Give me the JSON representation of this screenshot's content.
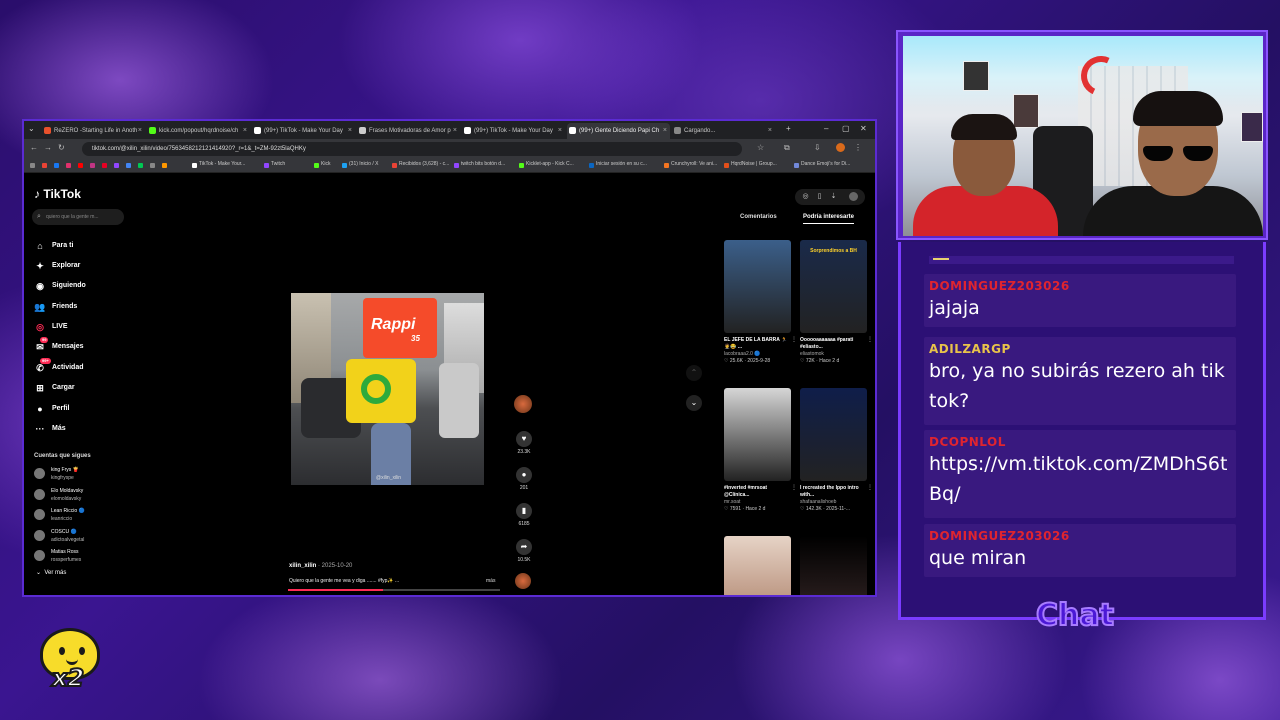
{
  "browser": {
    "tabs": [
      {
        "label": "ReZERO -Starting Life in Anoth",
        "color": "#e8512c",
        "active": false
      },
      {
        "label": "kick.com/popout/hqrdnoise/ch",
        "color": "#53fc18",
        "active": false
      },
      {
        "label": "(99+) TikTok - Make Your Day",
        "color": "#ffffff",
        "active": false
      },
      {
        "label": "Frases Motivadoras de Amor p",
        "color": "#cccccc",
        "active": false
      },
      {
        "label": "(99+) TikTok - Make Your Day",
        "color": "#ffffff",
        "active": false
      },
      {
        "label": "(99+) Gente Diciendo Papi Ch",
        "color": "#ffffff",
        "active": true
      },
      {
        "label": "Cargando...",
        "color": "#888888",
        "active": false
      }
    ],
    "new_tab": "+",
    "window_controls": [
      "–",
      "▢",
      "✕"
    ],
    "url": "tiktok.com/@xilin_xilin/video/7563458212121414920?_r=1&_t=ZM-92zt5laQHKy",
    "bookmarks": [
      "TikTok - Make Your...",
      "Twitch",
      "Kick",
      "(31) Inicio / X",
      "Recibidos (3,628) - c...",
      "twitch bits botón d...",
      "Kicklet-app - Kick C...",
      "Iniciar sesión en su c...",
      "Crunchyroll: Ve ani...",
      "HqrdNoise | Group...",
      "Dance Emoji's for Di..."
    ]
  },
  "tiktok": {
    "logo": "TikTok",
    "search_placeholder": "quiero que la gente m...",
    "nav": [
      {
        "label": "Para ti",
        "icon": "⌂"
      },
      {
        "label": "Explorar",
        "icon": "✦"
      },
      {
        "label": "Siguiendo",
        "icon": "◉"
      },
      {
        "label": "Friends",
        "icon": "👥"
      },
      {
        "label": "LIVE",
        "icon": "◎"
      },
      {
        "label": "Mensajes",
        "icon": "✉",
        "badge": "99"
      },
      {
        "label": "Actividad",
        "icon": "✆",
        "badge": "99+"
      },
      {
        "label": "Cargar",
        "icon": "⊞"
      },
      {
        "label": "Perfil",
        "icon": "●"
      },
      {
        "label": "Más",
        "icon": "···"
      }
    ],
    "following_title": "Cuentas que sigues",
    "following": [
      {
        "name": "king Frys 🍟",
        "handle": "kingfryspe"
      },
      {
        "name": "Elo Moldavsky",
        "handle": "elomoldavsky"
      },
      {
        "name": "Lean Riccio 🔵",
        "handle": "leanriccio"
      },
      {
        "name": "COSCU 🔵",
        "handle": "adictoalvegetal"
      },
      {
        "name": "Matias Ross",
        "handle": "rossperfumes"
      }
    ],
    "see_more": "Ver más",
    "video": {
      "bag_text": "Rappi",
      "bag_num": "35",
      "watermark": "@xilin_xilin",
      "author": "xilin_xilin",
      "date": "· 2025-10-20",
      "caption": "Quiero que la gente me vea y diga ....... #fyp✨ ...",
      "more": "más",
      "progress": 0.45
    },
    "actions": {
      "likes": "23.3K",
      "comments": "201",
      "saves": "6185",
      "shares": "10.5K"
    },
    "panel_tabs": [
      "Comentarios",
      "Podría interesarte"
    ],
    "cards": [
      {
        "title": "EL JEFE DE LA BARRA 🏃🤵😂 ...",
        "author": "lacobraaa2.0 🔵",
        "stats": "♡ 25.6K · 2025-9-28",
        "thumb": "#3b5f8a",
        "overlay": ""
      },
      {
        "title": "Oooooaaaaaaa #parati #eliasto...",
        "author": "eliastomok",
        "stats": "♡ 72K · Hace 2 d",
        "thumb": "#1a2a4a",
        "overlay": "Sorprendimos a BH"
      },
      {
        "title": "#inverted #mrsoat @Clínica...",
        "author": "mr.soat",
        "stats": "♡ 7591 · Hace 2 d",
        "thumb": "#d6d6d6",
        "overlay": ""
      },
      {
        "title": "I recreated the Ippo intro with...",
        "author": "shafaanalishoeb",
        "stats": "♡ 142.3K · 2025-11-...",
        "thumb": "#0f1e4a",
        "overlay": ""
      }
    ]
  },
  "chat": {
    "messages": [
      {
        "user": "DOMINGUEZ203026",
        "color": "#e0242f",
        "text": "jajaja"
      },
      {
        "user": "ADILZARGP",
        "color": "#e9c34a",
        "text": "bro, ya no subirás rezero ah tiktok?"
      },
      {
        "user": "DCOPNLOL",
        "color": "#e0242f",
        "text": "https://vm.tiktok.com/ZMDhS6tBq/"
      },
      {
        "user": "DOMINGUEZ203026",
        "color": "#e0242f",
        "text": "que miran"
      }
    ],
    "label": "Chat"
  },
  "sub_badge": {
    "text": "x2"
  }
}
